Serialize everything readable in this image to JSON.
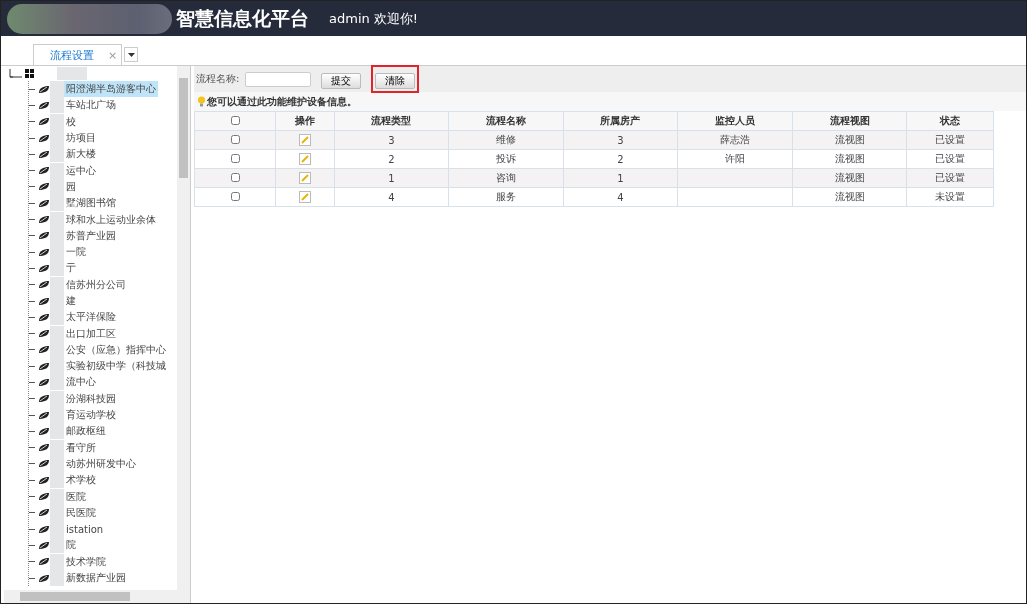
{
  "header": {
    "title": "智慧信息化平台",
    "welcome": "admin 欢迎你!"
  },
  "tabs": [
    {
      "label": "流程设置",
      "selected": true,
      "close": "×"
    }
  ],
  "tree": {
    "expanded": true,
    "children": [
      {
        "label": "阳澄湖半岛游客中心",
        "selected": true
      },
      {
        "label": "车站北广场",
        "selected": false
      },
      {
        "label": "校",
        "selected": false
      },
      {
        "label": "坊项目",
        "selected": false
      },
      {
        "label": "新大楼",
        "selected": false
      },
      {
        "label": "运中心",
        "selected": false
      },
      {
        "label": "园",
        "selected": false
      },
      {
        "label": "墅湖图书馆",
        "selected": false
      },
      {
        "label": "球和水上运动业余体",
        "selected": false
      },
      {
        "label": "苏普产业园",
        "selected": false
      },
      {
        "label": "一院",
        "selected": false
      },
      {
        "label": "亍",
        "selected": false
      },
      {
        "label": "信苏州分公司",
        "selected": false
      },
      {
        "label": "建",
        "selected": false
      },
      {
        "label": "太平洋保险",
        "selected": false
      },
      {
        "label": "出口加工区",
        "selected": false
      },
      {
        "label": "公安（应急）指挥中心",
        "selected": false
      },
      {
        "label": "实验初级中学（科技城",
        "selected": false
      },
      {
        "label": "流中心",
        "selected": false
      },
      {
        "label": "汾湖科技园",
        "selected": false
      },
      {
        "label": "育运动学校",
        "selected": false
      },
      {
        "label": "邮政枢纽",
        "selected": false
      },
      {
        "label": "看守所",
        "selected": false
      },
      {
        "label": "动苏州研发中心",
        "selected": false
      },
      {
        "label": "术学校",
        "selected": false
      },
      {
        "label": "医院",
        "selected": false
      },
      {
        "label": "民医院",
        "selected": false
      },
      {
        "label": "istation",
        "selected": false
      },
      {
        "label": "院",
        "selected": false
      },
      {
        "label": "技术学院",
        "selected": false
      },
      {
        "label": "新数据产业园",
        "selected": false
      }
    ]
  },
  "search": {
    "label": "流程名称:"
  },
  "buttons": [
    {
      "label": "提交",
      "highlighted": false
    },
    {
      "label": "清除",
      "highlighted": true
    }
  ],
  "hint": "您可以通过此功能维护设备信息。",
  "table": {
    "header_checked": false,
    "columns": [
      "",
      "操作",
      "流程类型",
      "流程名称",
      "所属房产",
      "监控人员",
      "流程视图",
      "状态"
    ],
    "rows": [
      {
        "checked": false,
        "cells": [
          "",
          "",
          "3",
          "维修",
          "3",
          "薛志浩",
          "流视图",
          "已设置"
        ]
      },
      {
        "checked": false,
        "cells": [
          "",
          "",
          "2",
          "投诉",
          "2",
          "许阳",
          "流视图",
          "已设置"
        ]
      },
      {
        "checked": false,
        "cells": [
          "",
          "",
          "1",
          "咨询",
          "1",
          "",
          "流视图",
          "已设置"
        ]
      },
      {
        "checked": false,
        "cells": [
          "",
          "",
          "4",
          "服务",
          "4",
          "",
          "流视图",
          "未设置"
        ]
      }
    ]
  }
}
